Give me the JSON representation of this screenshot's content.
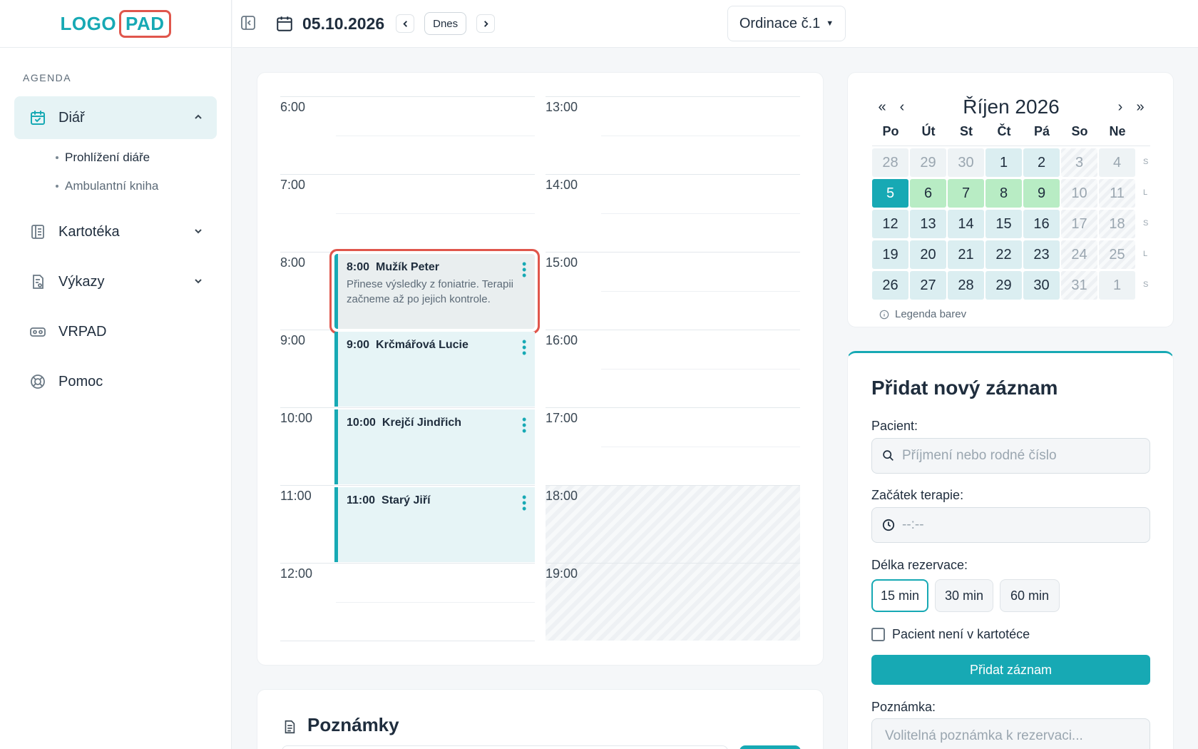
{
  "logo": {
    "part1": "LOGO",
    "part2": "PAD"
  },
  "sidebar": {
    "section": "AGENDA",
    "diar": {
      "label": "Diář"
    },
    "diar_sub": [
      "Prohlížení diáře",
      "Ambulantní kniha"
    ],
    "kartoteka": "Kartotéka",
    "vykazy": "Výkazy",
    "vrpad": "VRPAD",
    "pomoc": "Pomoc"
  },
  "topbar": {
    "date": "05.10.2026",
    "today": "Dnes",
    "office": "Ordinace č.1"
  },
  "schedule": {
    "hours_left": [
      "6:00",
      "7:00",
      "8:00",
      "9:00",
      "10:00",
      "11:00",
      "12:00"
    ],
    "hours_right": [
      "13:00",
      "14:00",
      "15:00",
      "16:00",
      "17:00",
      "18:00",
      "19:00"
    ],
    "appointments": [
      {
        "time": "8:00",
        "name": "Mužík Peter",
        "note": "Přinese výsledky z foniatrie. Terapii začneme až po jejich kontrole."
      },
      {
        "time": "9:00",
        "name": "Krčmářová Lucie",
        "note": ""
      },
      {
        "time": "10:00",
        "name": "Krejčí Jindřich",
        "note": ""
      },
      {
        "time": "11:00",
        "name": "Starý Jiří",
        "note": ""
      }
    ]
  },
  "notes": {
    "title": "Poznámky"
  },
  "calendar": {
    "title": "Říjen 2026",
    "nav": {
      "first": "«",
      "prev": "‹",
      "next": "›",
      "last": "»"
    },
    "weekdays": [
      "Po",
      "Út",
      "St",
      "Čt",
      "Pá",
      "So",
      "Ne"
    ],
    "weeks": [
      {
        "days": [
          "28",
          "29",
          "30",
          "1",
          "2",
          "3",
          "4"
        ],
        "kinds": [
          "other",
          "other",
          "other",
          "normal",
          "normal",
          "weekend",
          "weekend-other"
        ],
        "shift": "S"
      },
      {
        "days": [
          "5",
          "6",
          "7",
          "8",
          "9",
          "10",
          "11"
        ],
        "kinds": [
          "today",
          "green",
          "green",
          "green",
          "green",
          "weekend",
          "weekend"
        ],
        "shift": "L"
      },
      {
        "days": [
          "12",
          "13",
          "14",
          "15",
          "16",
          "17",
          "18"
        ],
        "kinds": [
          "normal",
          "normal",
          "normal",
          "normal",
          "normal",
          "weekend",
          "weekend"
        ],
        "shift": "S"
      },
      {
        "days": [
          "19",
          "20",
          "21",
          "22",
          "23",
          "24",
          "25"
        ],
        "kinds": [
          "normal",
          "normal",
          "normal",
          "normal",
          "normal",
          "weekend",
          "weekend"
        ],
        "shift": "L"
      },
      {
        "days": [
          "26",
          "27",
          "28",
          "29",
          "30",
          "31",
          "1"
        ],
        "kinds": [
          "normal",
          "normal",
          "normal",
          "normal",
          "normal",
          "weekend",
          "weekend-other"
        ],
        "shift": "S"
      }
    ],
    "legend": "Legenda barev"
  },
  "form": {
    "title": "Přidat nový záznam",
    "patient_label": "Pacient:",
    "patient_placeholder": "Příjmení nebo rodné číslo",
    "start_label": "Začátek terapie:",
    "start_placeholder": "--:--",
    "duration_label": "Délka rezervace:",
    "durations": [
      "15 min",
      "30 min",
      "60 min"
    ],
    "not_in_file": "Pacient není v kartotéce",
    "submit": "Přidat záznam",
    "note_label": "Poznámka:",
    "note_placeholder": "Volitelná poznámka k rezervaci..."
  },
  "colors": {
    "accent": "#17a9b4",
    "highlight": "#e0564c",
    "green_day": "#b8ecc4"
  },
  "icons": [
    "calendar-check-icon",
    "book-icon",
    "report-icon",
    "vr-headset-icon",
    "lifebuoy-icon",
    "sidebar-collapse-icon",
    "calendar-icon",
    "document-icon",
    "search-icon",
    "clock-icon",
    "info-icon"
  ]
}
